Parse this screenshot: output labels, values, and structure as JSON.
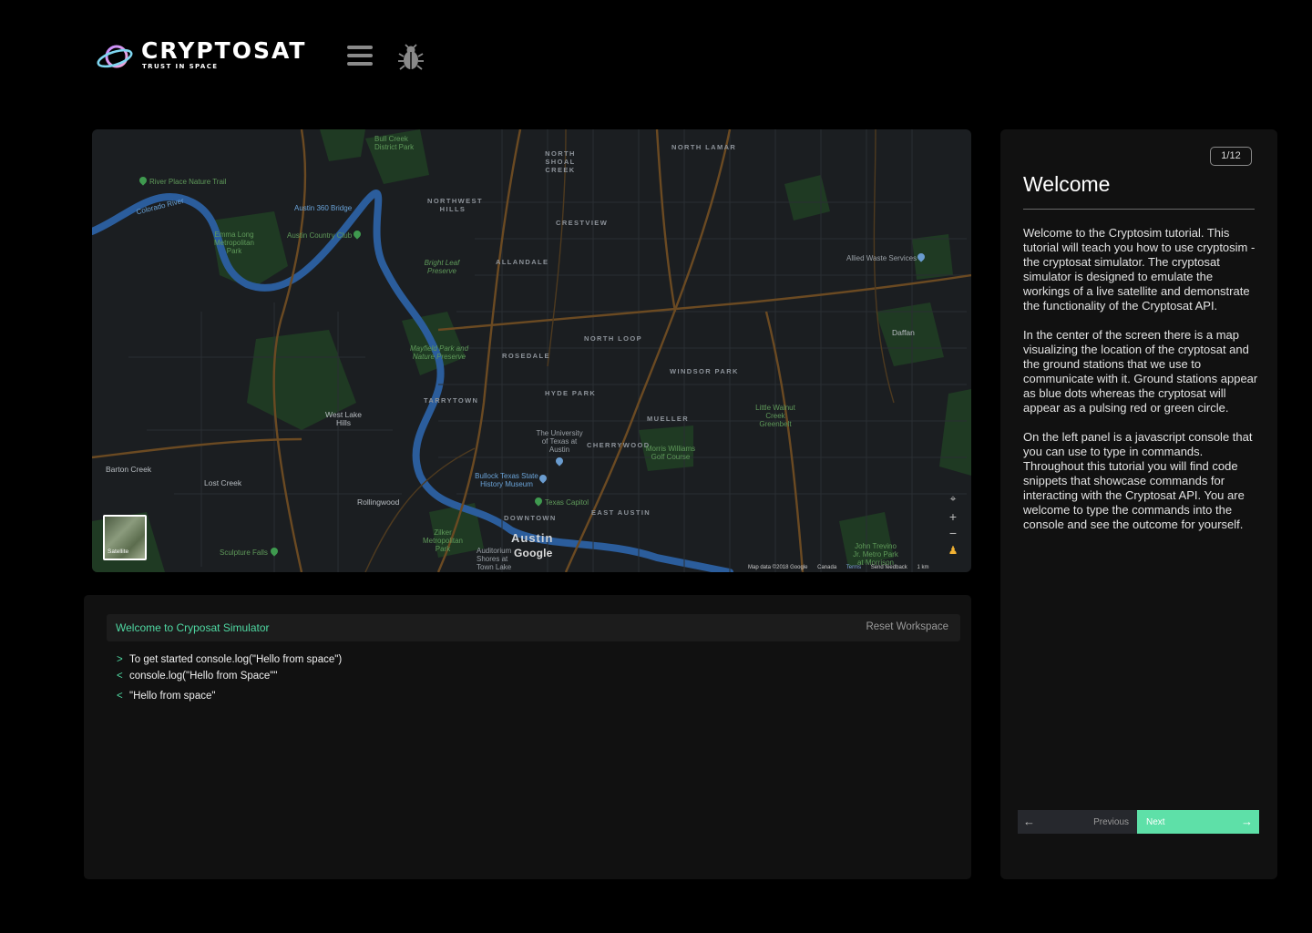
{
  "header": {
    "brand": "CRYPTOSAT",
    "tagline": "TRUST IN SPACE",
    "menu_icon": "hamburger-icon",
    "debug_icon": "bug-icon"
  },
  "map": {
    "districts": [
      "NORTH SHOAL CREEK",
      "NORTH LAMAR",
      "NORTHWEST HILLS",
      "CRESTVIEW",
      "ALLANDALE",
      "NORTH LOOP",
      "ROSEDALE",
      "WINDSOR PARK",
      "HYDE PARK",
      "TARRYTOWN",
      "MUELLER",
      "CHERRYWOOD",
      "EAST AUSTIN",
      "DOWNTOWN"
    ],
    "places": [
      "Bull Creek District Park",
      "River Place Nature Trail",
      "Austin 360 Bridge",
      "Austin Country Club",
      "Emma Long Metropolitan Park",
      "Bright Leaf Preserve",
      "Mayfield Park and Nature Preserve",
      "Allied Waste Services",
      "Daffan",
      "Little Walnut Creek Greenbelt",
      "West Lake Hills",
      "Barton Creek",
      "Lost Creek",
      "Rollingwood",
      "The University of Texas at Austin",
      "Morris Williams Golf Course",
      "Bullock Texas State History Museum",
      "Texas Capitol",
      "Zilker Metropolitan Park",
      "Sculpture Falls",
      "Auditorium Shores at Town Lake",
      "John Trevino Jr. Metro Park at Morrison",
      "Colorado River"
    ],
    "city": "Austin",
    "google": "Google",
    "satellite_label": "Satellite",
    "attribution": [
      "Map data ©2018 Google",
      "Canada",
      "Terms",
      "Send feedback",
      "1 km"
    ]
  },
  "console": {
    "title": "Welcome to Cryposat Simulator",
    "reset_label": "Reset Workspace",
    "lines": [
      {
        "sym": ">",
        "text": "To get started console.log(\"Hello from space\")"
      },
      {
        "sym": "<",
        "text": "console.log(\"Hello from Space\"\""
      },
      {
        "sym": "<",
        "text": "\"Hello from space\""
      }
    ]
  },
  "tutorial": {
    "step": "1/12",
    "title": "Welcome",
    "paragraphs": [
      "Welcome to the Cryptosim tutorial. This tutorial will teach you how to use cryptosim - the cryptosat simulator. The cryptosat simulator is designed to emulate the workings of a live satellite and demonstrate the functionality of the Cryptosat API.",
      "In the center of the screen there is a map visualizing the location of the cryptosat and the ground stations that we use to communicate with it. Ground stations appear as blue dots whereas the cryptosat will appear as a pulsing red or green circle.",
      "On the left panel is a javascript console that you can use to type in commands. Throughout this tutorial you will find code snippets that showcase commands for interacting with the Cryptosat API. You are welcome to type the commands into the console and see the outcome for yourself."
    ],
    "prev_label": "Previous",
    "next_label": "Next"
  },
  "colors": {
    "accent": "#5ee0a8",
    "console_accent": "#4fd8a2",
    "panel": "#111111",
    "map_bg": "#1b1e21",
    "river": "#2b5d9c"
  }
}
